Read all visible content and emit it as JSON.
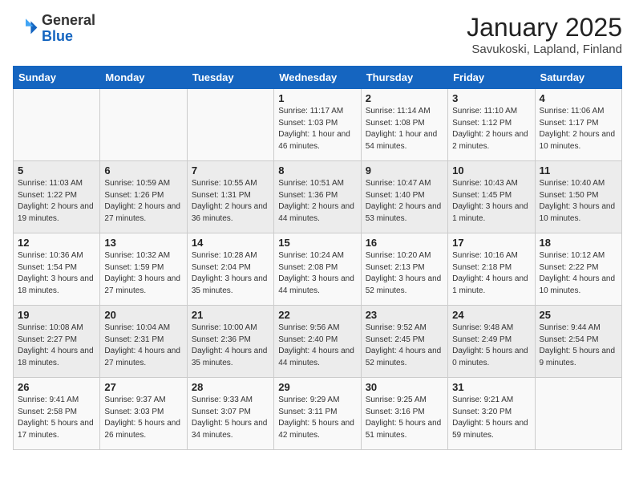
{
  "header": {
    "logo_general": "General",
    "logo_blue": "Blue",
    "title": "January 2025",
    "subtitle": "Savukoski, Lapland, Finland"
  },
  "weekdays": [
    "Sunday",
    "Monday",
    "Tuesday",
    "Wednesday",
    "Thursday",
    "Friday",
    "Saturday"
  ],
  "weeks": [
    [
      {
        "day": "",
        "info": ""
      },
      {
        "day": "",
        "info": ""
      },
      {
        "day": "",
        "info": ""
      },
      {
        "day": "1",
        "info": "Sunrise: 11:17 AM\nSunset: 1:03 PM\nDaylight: 1 hour and 46 minutes."
      },
      {
        "day": "2",
        "info": "Sunrise: 11:14 AM\nSunset: 1:08 PM\nDaylight: 1 hour and 54 minutes."
      },
      {
        "day": "3",
        "info": "Sunrise: 11:10 AM\nSunset: 1:12 PM\nDaylight: 2 hours and 2 minutes."
      },
      {
        "day": "4",
        "info": "Sunrise: 11:06 AM\nSunset: 1:17 PM\nDaylight: 2 hours and 10 minutes."
      }
    ],
    [
      {
        "day": "5",
        "info": "Sunrise: 11:03 AM\nSunset: 1:22 PM\nDaylight: 2 hours and 19 minutes."
      },
      {
        "day": "6",
        "info": "Sunrise: 10:59 AM\nSunset: 1:26 PM\nDaylight: 2 hours and 27 minutes."
      },
      {
        "day": "7",
        "info": "Sunrise: 10:55 AM\nSunset: 1:31 PM\nDaylight: 2 hours and 36 minutes."
      },
      {
        "day": "8",
        "info": "Sunrise: 10:51 AM\nSunset: 1:36 PM\nDaylight: 2 hours and 44 minutes."
      },
      {
        "day": "9",
        "info": "Sunrise: 10:47 AM\nSunset: 1:40 PM\nDaylight: 2 hours and 53 minutes."
      },
      {
        "day": "10",
        "info": "Sunrise: 10:43 AM\nSunset: 1:45 PM\nDaylight: 3 hours and 1 minute."
      },
      {
        "day": "11",
        "info": "Sunrise: 10:40 AM\nSunset: 1:50 PM\nDaylight: 3 hours and 10 minutes."
      }
    ],
    [
      {
        "day": "12",
        "info": "Sunrise: 10:36 AM\nSunset: 1:54 PM\nDaylight: 3 hours and 18 minutes."
      },
      {
        "day": "13",
        "info": "Sunrise: 10:32 AM\nSunset: 1:59 PM\nDaylight: 3 hours and 27 minutes."
      },
      {
        "day": "14",
        "info": "Sunrise: 10:28 AM\nSunset: 2:04 PM\nDaylight: 3 hours and 35 minutes."
      },
      {
        "day": "15",
        "info": "Sunrise: 10:24 AM\nSunset: 2:08 PM\nDaylight: 3 hours and 44 minutes."
      },
      {
        "day": "16",
        "info": "Sunrise: 10:20 AM\nSunset: 2:13 PM\nDaylight: 3 hours and 52 minutes."
      },
      {
        "day": "17",
        "info": "Sunrise: 10:16 AM\nSunset: 2:18 PM\nDaylight: 4 hours and 1 minute."
      },
      {
        "day": "18",
        "info": "Sunrise: 10:12 AM\nSunset: 2:22 PM\nDaylight: 4 hours and 10 minutes."
      }
    ],
    [
      {
        "day": "19",
        "info": "Sunrise: 10:08 AM\nSunset: 2:27 PM\nDaylight: 4 hours and 18 minutes."
      },
      {
        "day": "20",
        "info": "Sunrise: 10:04 AM\nSunset: 2:31 PM\nDaylight: 4 hours and 27 minutes."
      },
      {
        "day": "21",
        "info": "Sunrise: 10:00 AM\nSunset: 2:36 PM\nDaylight: 4 hours and 35 minutes."
      },
      {
        "day": "22",
        "info": "Sunrise: 9:56 AM\nSunset: 2:40 PM\nDaylight: 4 hours and 44 minutes."
      },
      {
        "day": "23",
        "info": "Sunrise: 9:52 AM\nSunset: 2:45 PM\nDaylight: 4 hours and 52 minutes."
      },
      {
        "day": "24",
        "info": "Sunrise: 9:48 AM\nSunset: 2:49 PM\nDaylight: 5 hours and 0 minutes."
      },
      {
        "day": "25",
        "info": "Sunrise: 9:44 AM\nSunset: 2:54 PM\nDaylight: 5 hours and 9 minutes."
      }
    ],
    [
      {
        "day": "26",
        "info": "Sunrise: 9:41 AM\nSunset: 2:58 PM\nDaylight: 5 hours and 17 minutes."
      },
      {
        "day": "27",
        "info": "Sunrise: 9:37 AM\nSunset: 3:03 PM\nDaylight: 5 hours and 26 minutes."
      },
      {
        "day": "28",
        "info": "Sunrise: 9:33 AM\nSunset: 3:07 PM\nDaylight: 5 hours and 34 minutes."
      },
      {
        "day": "29",
        "info": "Sunrise: 9:29 AM\nSunset: 3:11 PM\nDaylight: 5 hours and 42 minutes."
      },
      {
        "day": "30",
        "info": "Sunrise: 9:25 AM\nSunset: 3:16 PM\nDaylight: 5 hours and 51 minutes."
      },
      {
        "day": "31",
        "info": "Sunrise: 9:21 AM\nSunset: 3:20 PM\nDaylight: 5 hours and 59 minutes."
      },
      {
        "day": "",
        "info": ""
      }
    ]
  ]
}
